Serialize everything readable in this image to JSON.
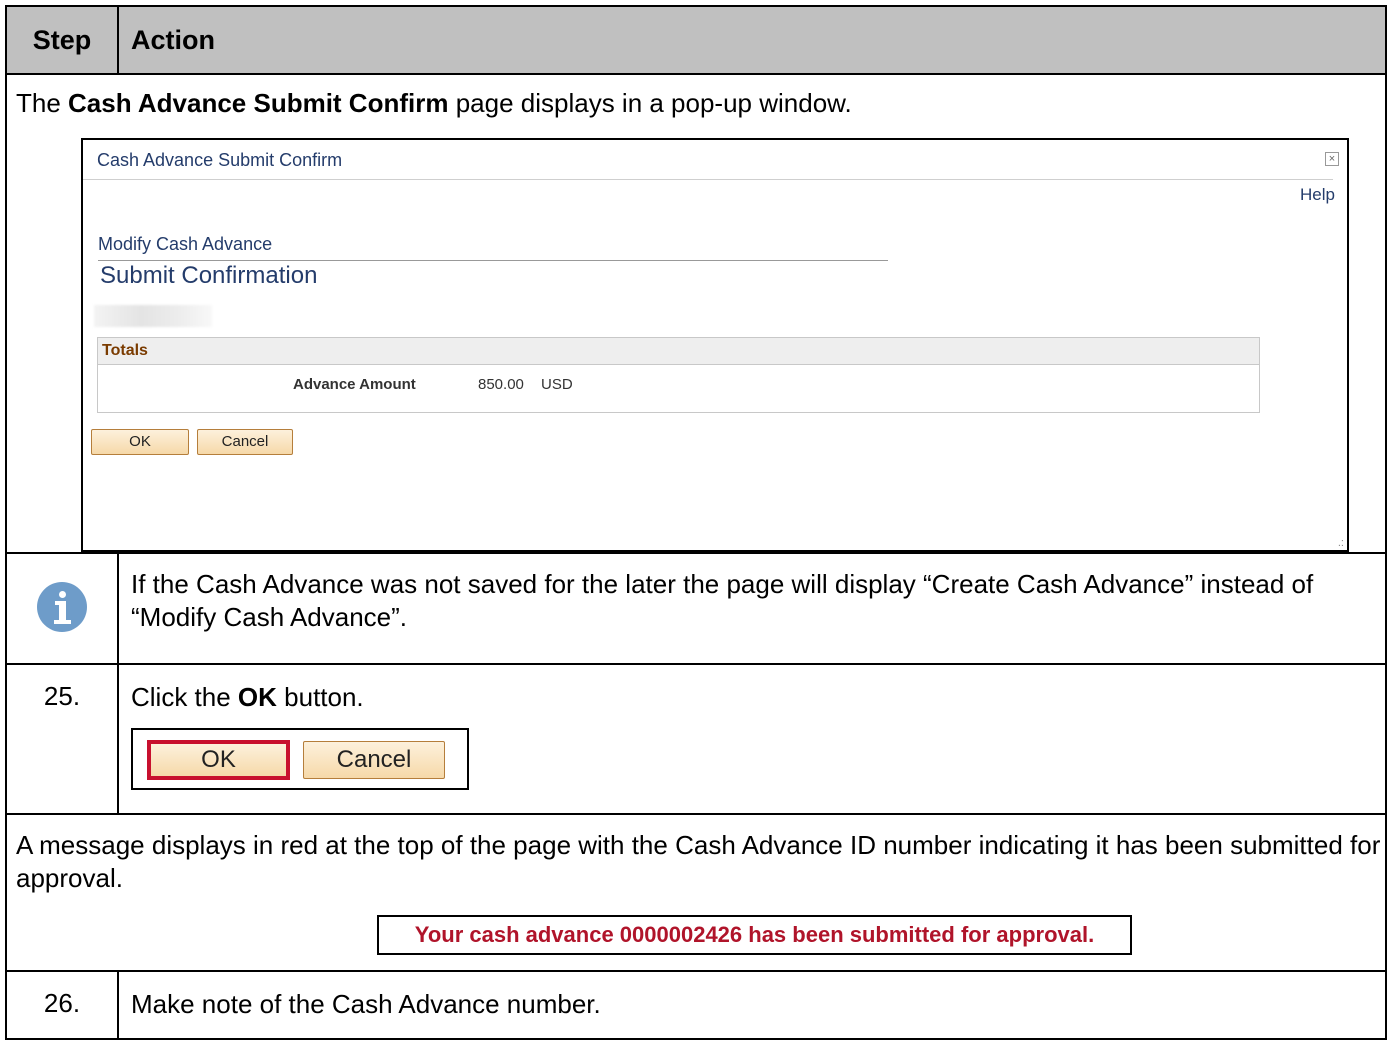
{
  "header": {
    "step": "Step",
    "action": "Action"
  },
  "intro": {
    "prefix": "The ",
    "bold": "Cash Advance Submit Confirm",
    "suffix": " page displays in a pop-up window."
  },
  "popup": {
    "title": "Cash Advance Submit Confirm",
    "close_glyph": "×",
    "help": "Help",
    "subtitle": "Modify Cash Advance",
    "heading": "Submit Confirmation",
    "totals_label": "Totals",
    "advance_label": "Advance Amount",
    "advance_value": "850.00",
    "advance_currency": "USD",
    "ok_label": "OK",
    "cancel_label": "Cancel"
  },
  "info_note": "If the Cash Advance was not saved for the later the page will display “Create Cash Advance” instead of “Modify Cash Advance”.",
  "step25": {
    "number": "25.",
    "prefix": "Click the ",
    "bold": "OK",
    "suffix": " button.",
    "ok_label": "OK",
    "cancel_label": "Cancel"
  },
  "message_row": {
    "text": "A message displays in red at the top of the page with the Cash Advance ID number indicating it has been submitted for approval.",
    "message": "Your cash advance 0000002426 has been submitted for approval."
  },
  "step26": {
    "number": "26.",
    "text": "Make note of the Cash Advance number."
  },
  "colors": {
    "header_bg": "#c0c0c0",
    "popup_text": "#243c6b",
    "message_red": "#b0142a",
    "highlight_red": "#c8102e",
    "info_icon": "#6e9cc9"
  },
  "icons": {
    "info": "info-icon",
    "close": "close-icon"
  }
}
